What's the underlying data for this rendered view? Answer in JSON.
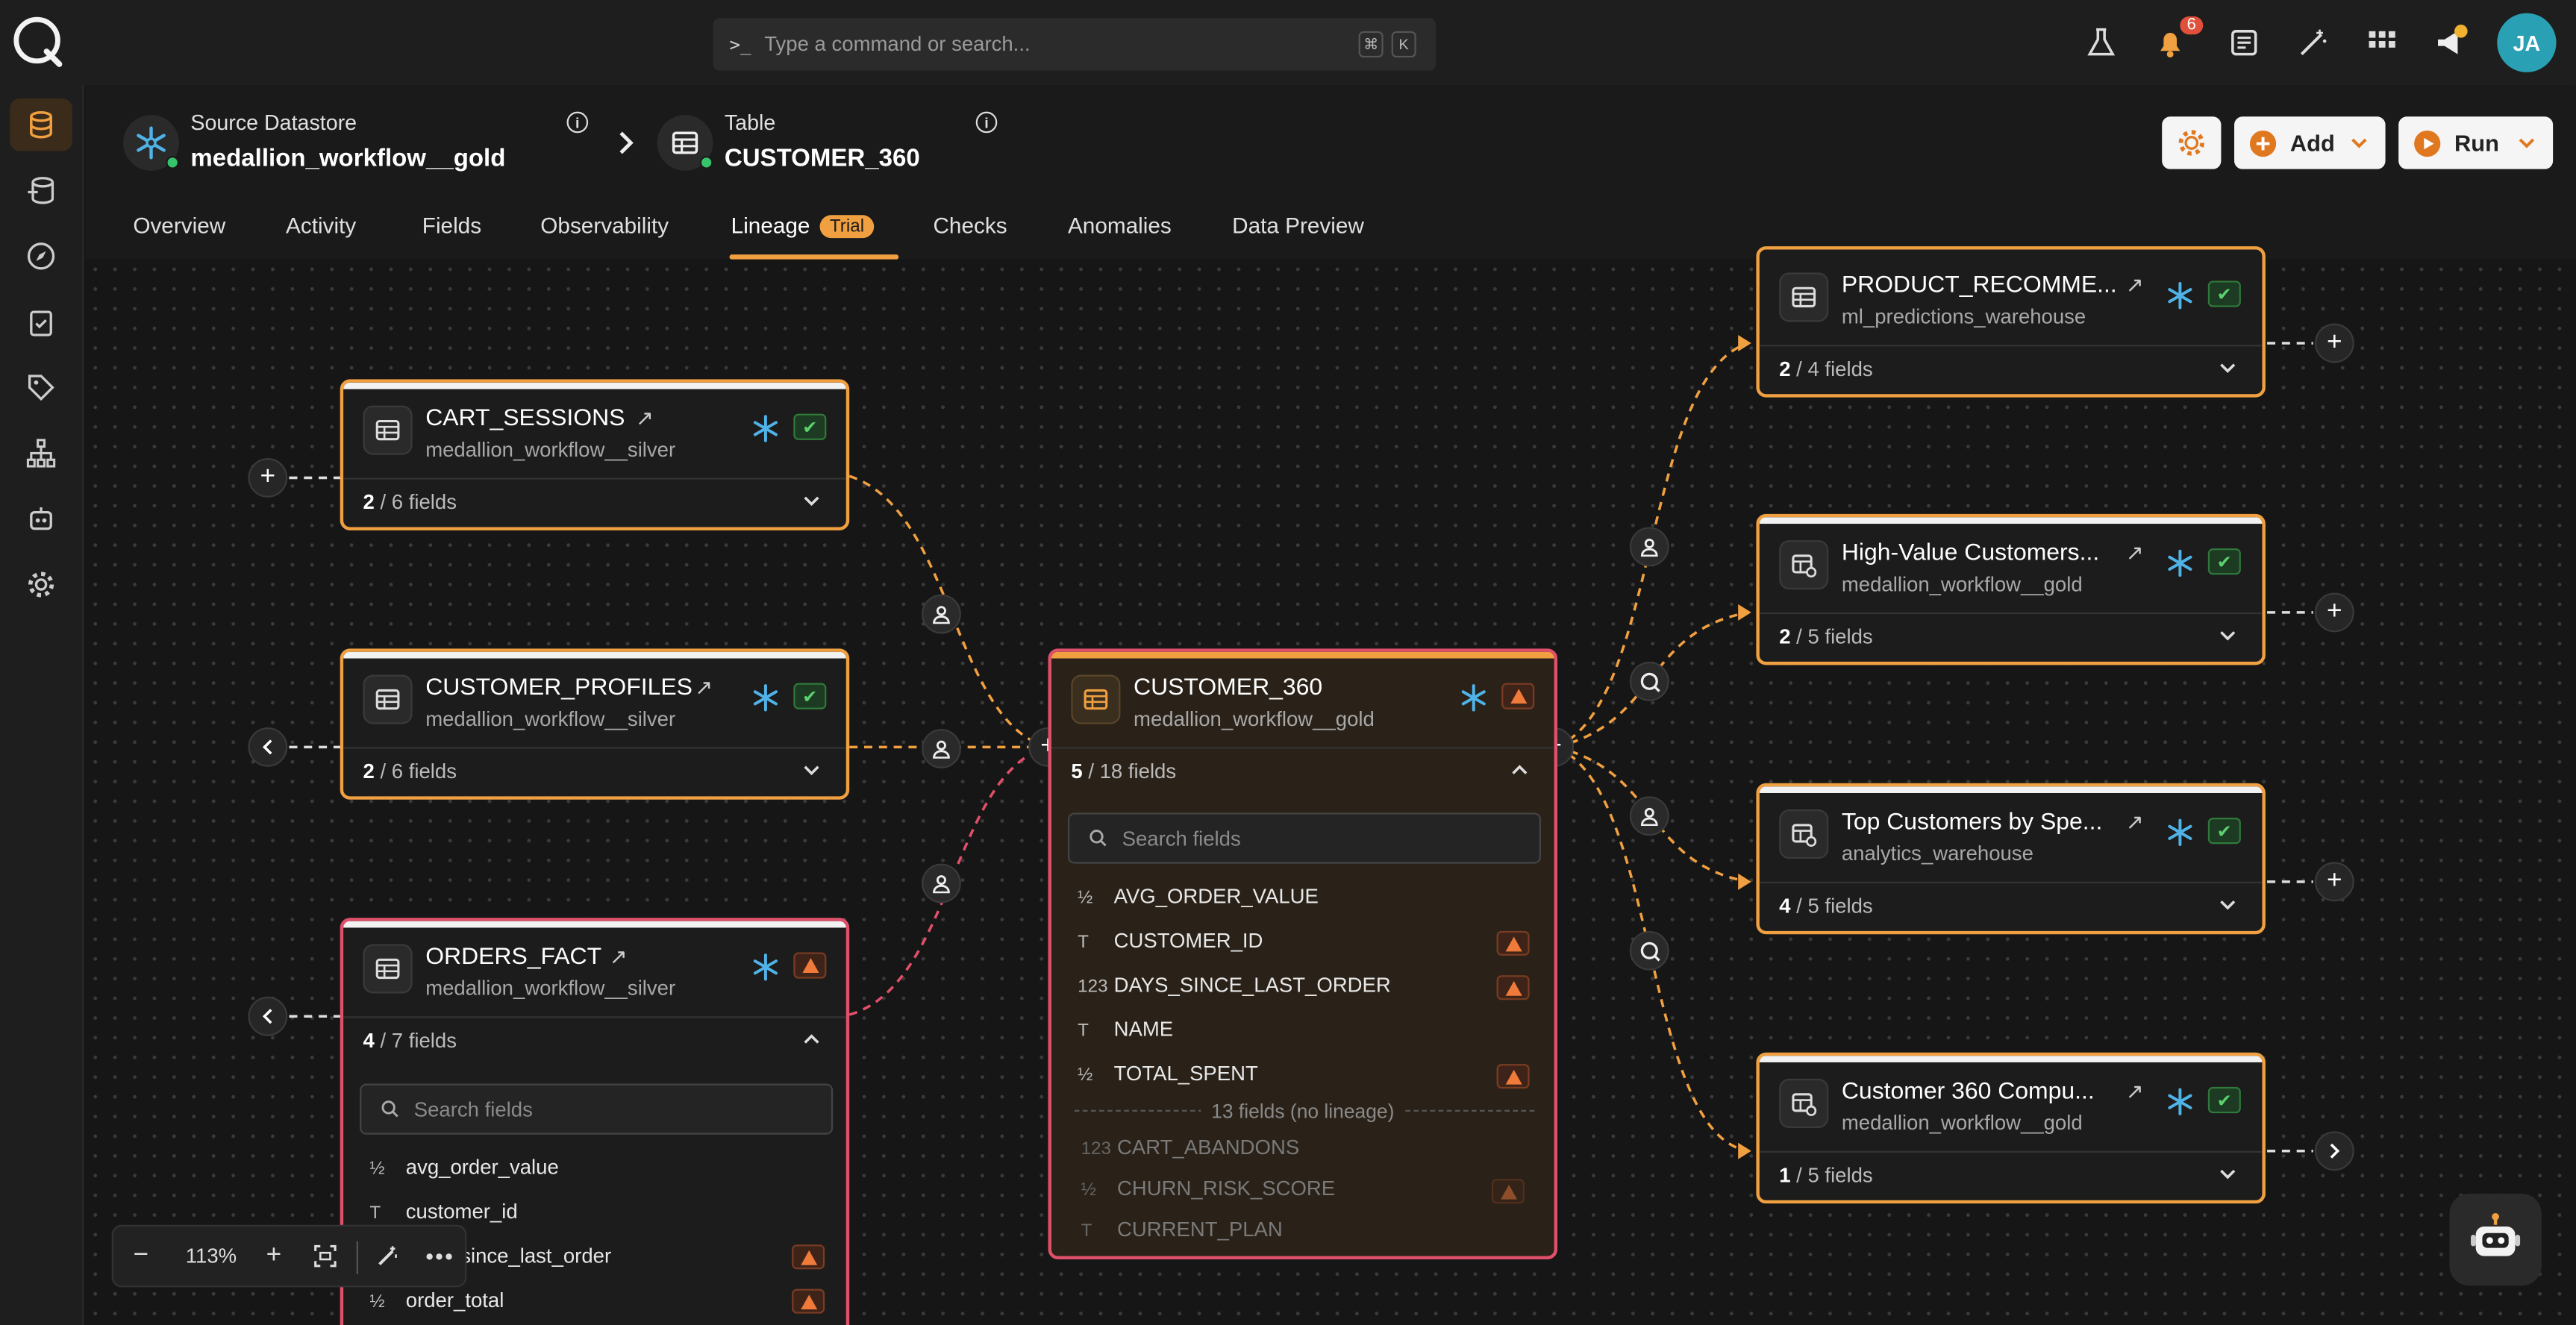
{
  "topbar": {
    "search_placeholder": "Type a command or search...",
    "shortcut_mod": "⌘",
    "shortcut_key": "K",
    "notification_count": "6",
    "avatar_initials": "JA"
  },
  "header": {
    "source_label": "Source Datastore",
    "source_value": "medallion_workflow__gold",
    "table_label": "Table",
    "table_value": "CUSTOMER_360",
    "add_label": "Add",
    "run_label": "Run"
  },
  "tabs": {
    "overview": "Overview",
    "activity": "Activity",
    "fields": "Fields",
    "observability": "Observability",
    "lineage": "Lineage",
    "trial": "Trial",
    "checks": "Checks",
    "anomalies": "Anomalies",
    "data_preview": "Data Preview"
  },
  "nodes": {
    "cart_sessions": {
      "title": "CART_SESSIONS",
      "sub": "medallion_workflow__silver",
      "sel": "2",
      "total": " / 6 fields"
    },
    "customer_profiles": {
      "title": "CUSTOMER_PROFILES",
      "sub": "medallion_workflow__silver",
      "sel": "2",
      "total": " / 6 fields"
    },
    "orders_fact": {
      "title": "ORDERS_FACT",
      "sub": "medallion_workflow__silver",
      "sel": "4",
      "total": " / 7 fields",
      "search": "Search fields",
      "fields": [
        {
          "t": "½",
          "n": "avg_order_value"
        },
        {
          "t": "T",
          "n": "customer_id"
        },
        {
          "t": "123",
          "n": "days_since_last_order"
        },
        {
          "t": "½",
          "n": "order_total"
        }
      ]
    },
    "customer_360": {
      "title": "CUSTOMER_360",
      "sub": "medallion_workflow__gold",
      "sel": "5",
      "total": " / 18 fields",
      "search": "Search fields",
      "fields": [
        {
          "t": "½",
          "n": "AVG_ORDER_VALUE"
        },
        {
          "t": "T",
          "n": "CUSTOMER_ID"
        },
        {
          "t": "123",
          "n": "DAYS_SINCE_LAST_ORDER"
        },
        {
          "t": "T",
          "n": "NAME"
        },
        {
          "t": "½",
          "n": "TOTAL_SPENT"
        }
      ],
      "no_lineage": "13 fields (no lineage)",
      "dim_fields": [
        {
          "t": "123",
          "n": "CART_ABANDONS"
        },
        {
          "t": "½",
          "n": "CHURN_RISK_SCORE"
        },
        {
          "t": "T",
          "n": "CURRENT_PLAN"
        }
      ]
    },
    "product_recommend": {
      "title": "PRODUCT_RECOMME...",
      "sub": "ml_predictions_warehouse",
      "sel": "2",
      "total": " / 4 fields"
    },
    "high_value": {
      "title": "High-Value Customers...",
      "sub": "medallion_workflow__gold",
      "sel": "2",
      "total": " / 5 fields"
    },
    "top_customers": {
      "title": "Top Customers by Spe...",
      "sub": "analytics_warehouse",
      "sel": "4",
      "total": " / 5 fields"
    },
    "customer_360_comp": {
      "title": "Customer 360 Compu...",
      "sub": "medallion_workflow__gold",
      "sel": "1",
      "total": " / 5 fields"
    }
  },
  "zoom": {
    "level": "113%"
  },
  "colors": {
    "accent": "#f0a040",
    "error": "#e0506a",
    "snowflake": "#4fb3e8",
    "ok": "#5bd16e"
  }
}
